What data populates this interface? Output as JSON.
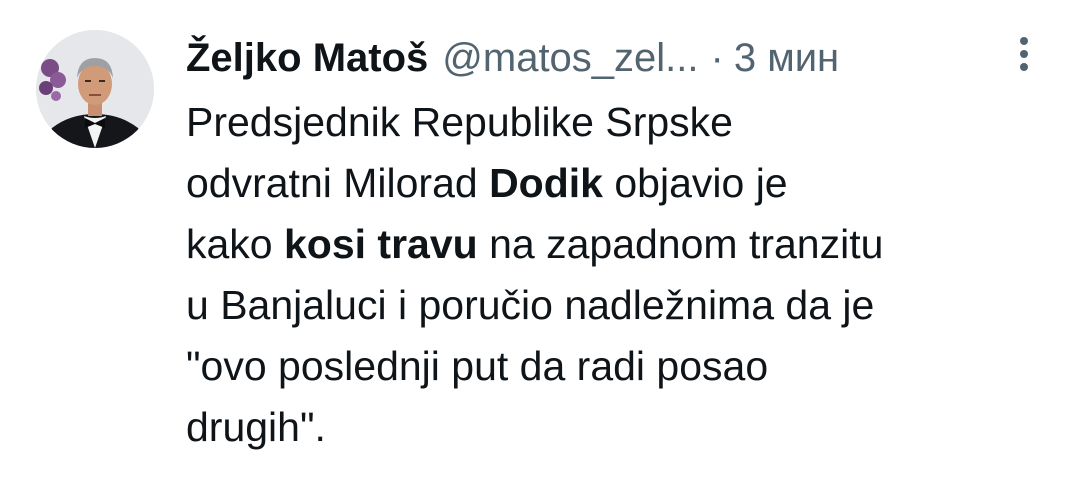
{
  "author": {
    "display_name": "Željko Matoš",
    "handle": "@matos_zel...",
    "separator": "·",
    "time": "3 мин",
    "avatar_icon": "profile-photo"
  },
  "more_icon": "vertical-ellipsis-icon",
  "colors": {
    "text_primary": "#0f1419",
    "text_secondary": "#536471",
    "background": "#ffffff"
  },
  "tweet_lines": [
    {
      "parts": [
        {
          "text": "Predsjednik Republike Srpske"
        }
      ]
    },
    {
      "parts": [
        {
          "text": "odvratni Milorad "
        },
        {
          "text": "Dodik",
          "bold": true
        },
        {
          "text": " objavio je"
        }
      ]
    },
    {
      "parts": [
        {
          "text": "kako "
        },
        {
          "text": "kosi travu",
          "bold": true
        },
        {
          "text": " na zapadnom tranzitu"
        }
      ]
    },
    {
      "parts": [
        {
          "text": "u Banjaluci i poručio nadležnima da je"
        }
      ]
    },
    {
      "parts": [
        {
          "text": "\"ovo poslednji put da radi posao"
        }
      ]
    },
    {
      "parts": [
        {
          "text": "drugih\"."
        }
      ]
    }
  ]
}
